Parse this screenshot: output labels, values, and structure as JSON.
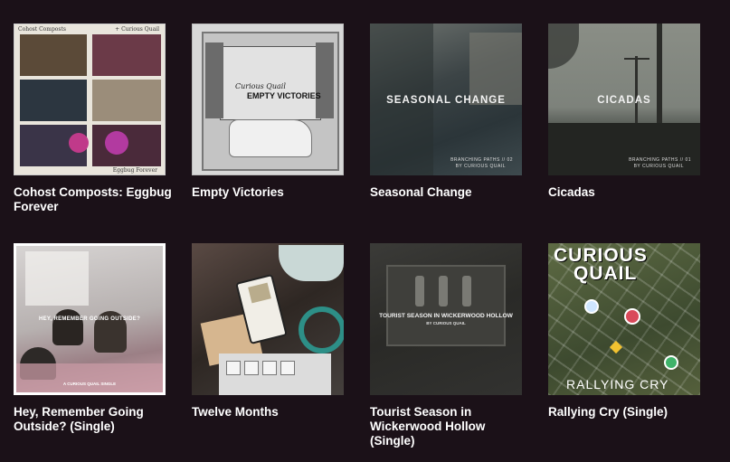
{
  "albums": [
    {
      "title": "Cohost Composts: Eggbug Forever",
      "cover_top_left": "Cohost Composts",
      "cover_top_right": "+ Curious Quail",
      "cover_bottom": "Eggbug Forever"
    },
    {
      "title": "Empty Victories",
      "cover_text_a": "Curious Quail",
      "cover_text_b": "EMPTY VICTORIES"
    },
    {
      "title": "Seasonal Change",
      "cover_text": "SEASONAL CHANGE",
      "cover_sub_a": "BRANCHING PATHS // 02",
      "cover_sub_b": "BY CURIOUS QUAIL"
    },
    {
      "title": "Cicadas",
      "cover_text": "CICADAS",
      "cover_sub_a": "BRANCHING PATHS // 01",
      "cover_sub_b": "BY CURIOUS QUAIL"
    },
    {
      "title": "Hey, Remember Going Outside? (Single)",
      "cover_text": "HEY, REMEMBER GOING OUTSIDE?",
      "cover_sub": "A CURIOUS QUAIL SINGLE"
    },
    {
      "title": "Twelve Months"
    },
    {
      "title": "Tourist Season in Wickerwood Hollow (Single)",
      "cover_text": "TOURIST SEASON IN WICKERWOOD HOLLOW",
      "cover_sub": "BY CURIOUS QUAIL"
    },
    {
      "title": "Rallying Cry (Single)",
      "cover_text_a": "CURIOUS",
      "cover_text_b": "QUAIL",
      "cover_bottom": "RALLYING CRY"
    }
  ],
  "colors": {
    "background": "#1b1118",
    "text": "#ffffff"
  }
}
